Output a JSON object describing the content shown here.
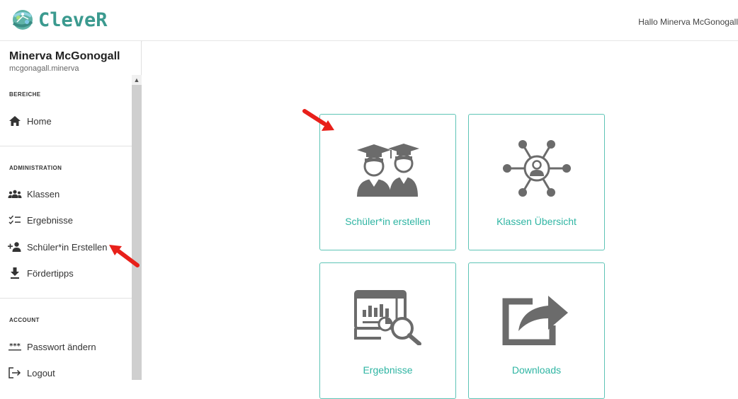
{
  "header": {
    "logo_text": "CleveR",
    "greeting": "Hallo Minerva McGonogall"
  },
  "sidebar": {
    "user_name": "Minerva McGonogall",
    "user_login": "mcgonagall.minerva",
    "sections": [
      {
        "title": "BEREICHE",
        "items": [
          {
            "label": "Home",
            "icon": "home-icon"
          }
        ]
      },
      {
        "title": "ADMINISTRATION",
        "items": [
          {
            "label": "Klassen",
            "icon": "group-icon"
          },
          {
            "label": "Ergebnisse",
            "icon": "checklist-icon"
          },
          {
            "label": "Schüler*in Erstellen",
            "icon": "add-person-icon"
          },
          {
            "label": "Fördertipps",
            "icon": "download-icon"
          }
        ]
      },
      {
        "title": "ACCOUNT",
        "items": [
          {
            "label": "Passwort ändern",
            "icon": "password-icon"
          },
          {
            "label": "Logout",
            "icon": "logout-icon"
          }
        ]
      }
    ]
  },
  "tiles": [
    {
      "label": "Schüler*in erstellen",
      "icon": "graduates-icon"
    },
    {
      "label": "Klassen Übersicht",
      "icon": "network-icon"
    },
    {
      "label": "Ergebnisse",
      "icon": "report-analysis-icon"
    },
    {
      "label": "Downloads",
      "icon": "share-export-icon"
    }
  ],
  "colors": {
    "accent": "#2fb5a3",
    "tile_border": "#5ec4b6",
    "icon_gray": "#6b6b6b",
    "annotation_red": "#e8201a"
  }
}
